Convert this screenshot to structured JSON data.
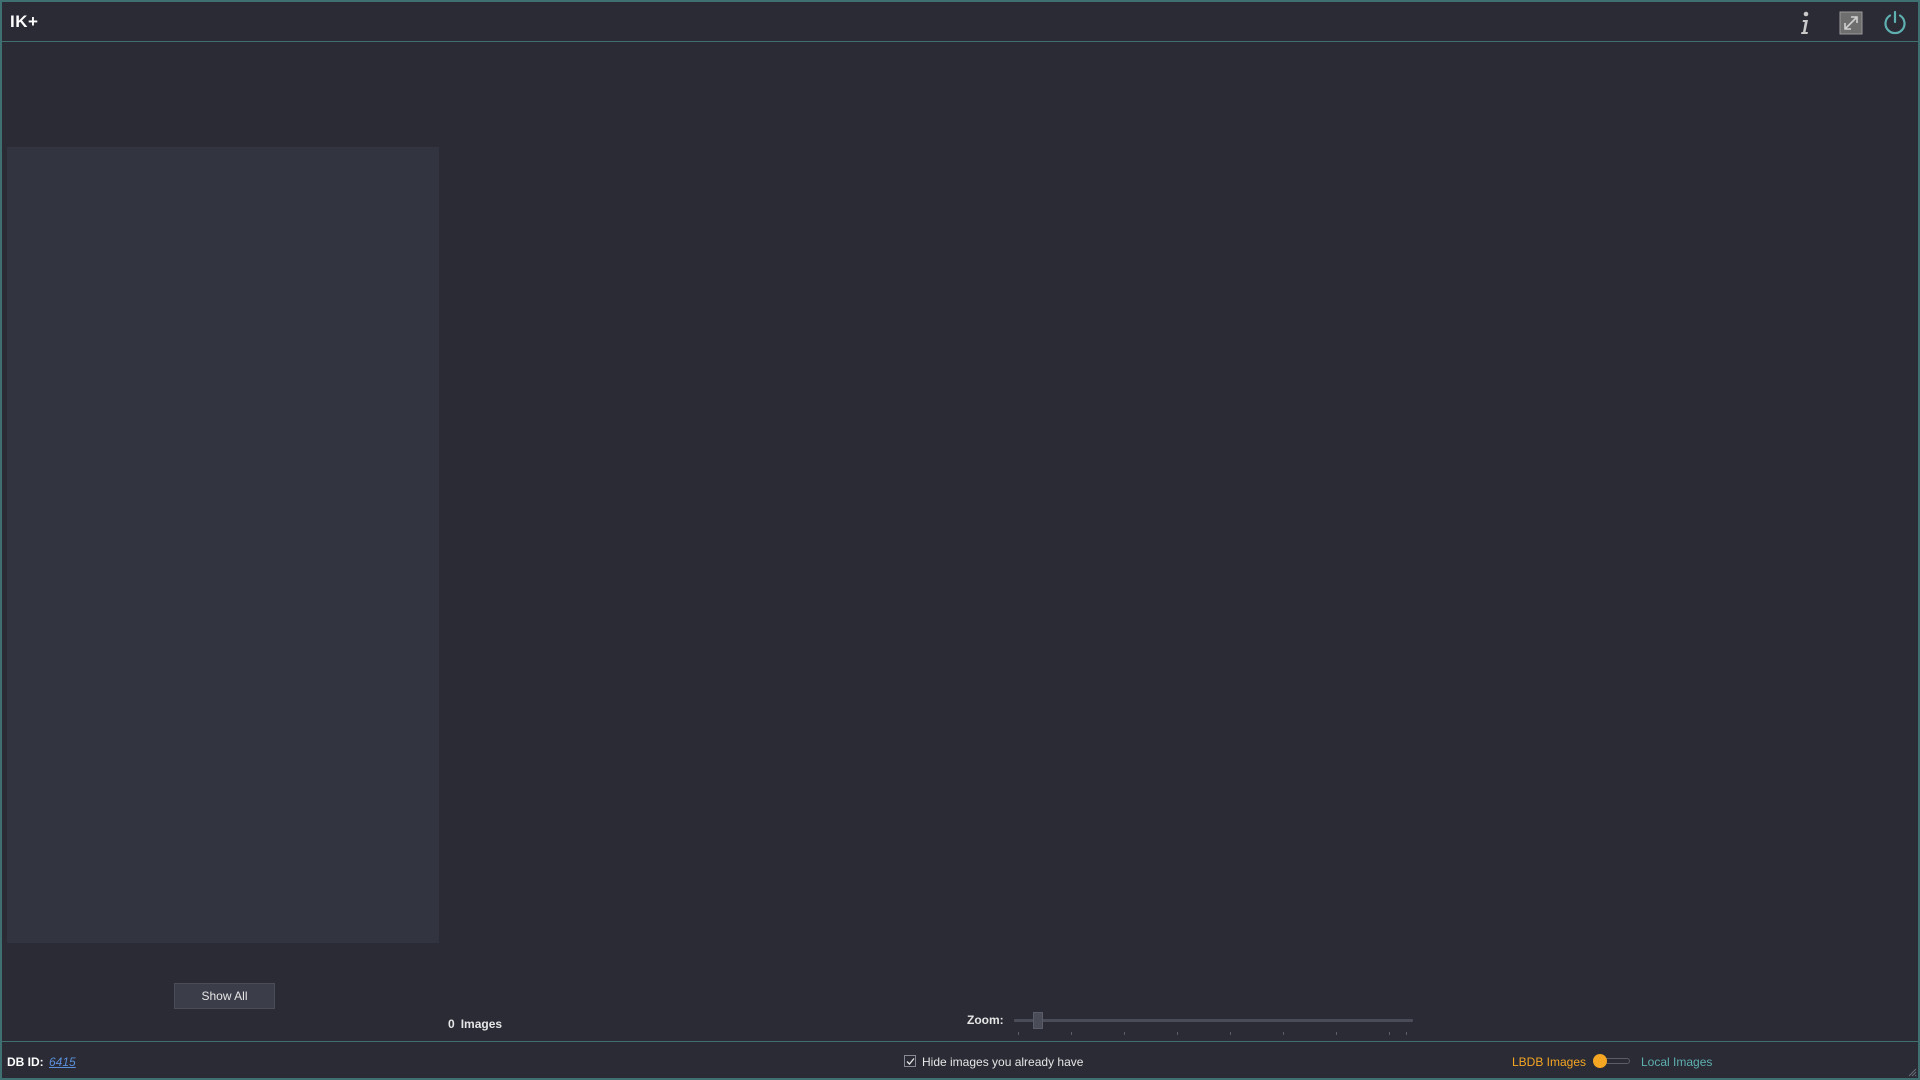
{
  "app": {
    "title": "IK+"
  },
  "titlebar": {
    "info_icon": "info-icon",
    "resize_icon": "resize-icon",
    "power_icon": "power-icon"
  },
  "sidebar": {
    "show_all_label": "Show All"
  },
  "results": {
    "count": "0",
    "count_label": "Images"
  },
  "zoom": {
    "label": "Zoom:",
    "value": 0.05
  },
  "footer": {
    "db_id_label": "DB ID:",
    "db_id_value": "6415",
    "hide_owned_label": "Hide images you already have",
    "hide_owned_checked": true,
    "source_left_label": "LBDB Images",
    "source_right_label": "Local Images"
  },
  "colors": {
    "background": "#2a2b35",
    "panel": "#323440",
    "accent_border": "#3f6f70",
    "orange": "#f5a623",
    "teal": "#5fb0b0",
    "link": "#5b8fd8"
  }
}
